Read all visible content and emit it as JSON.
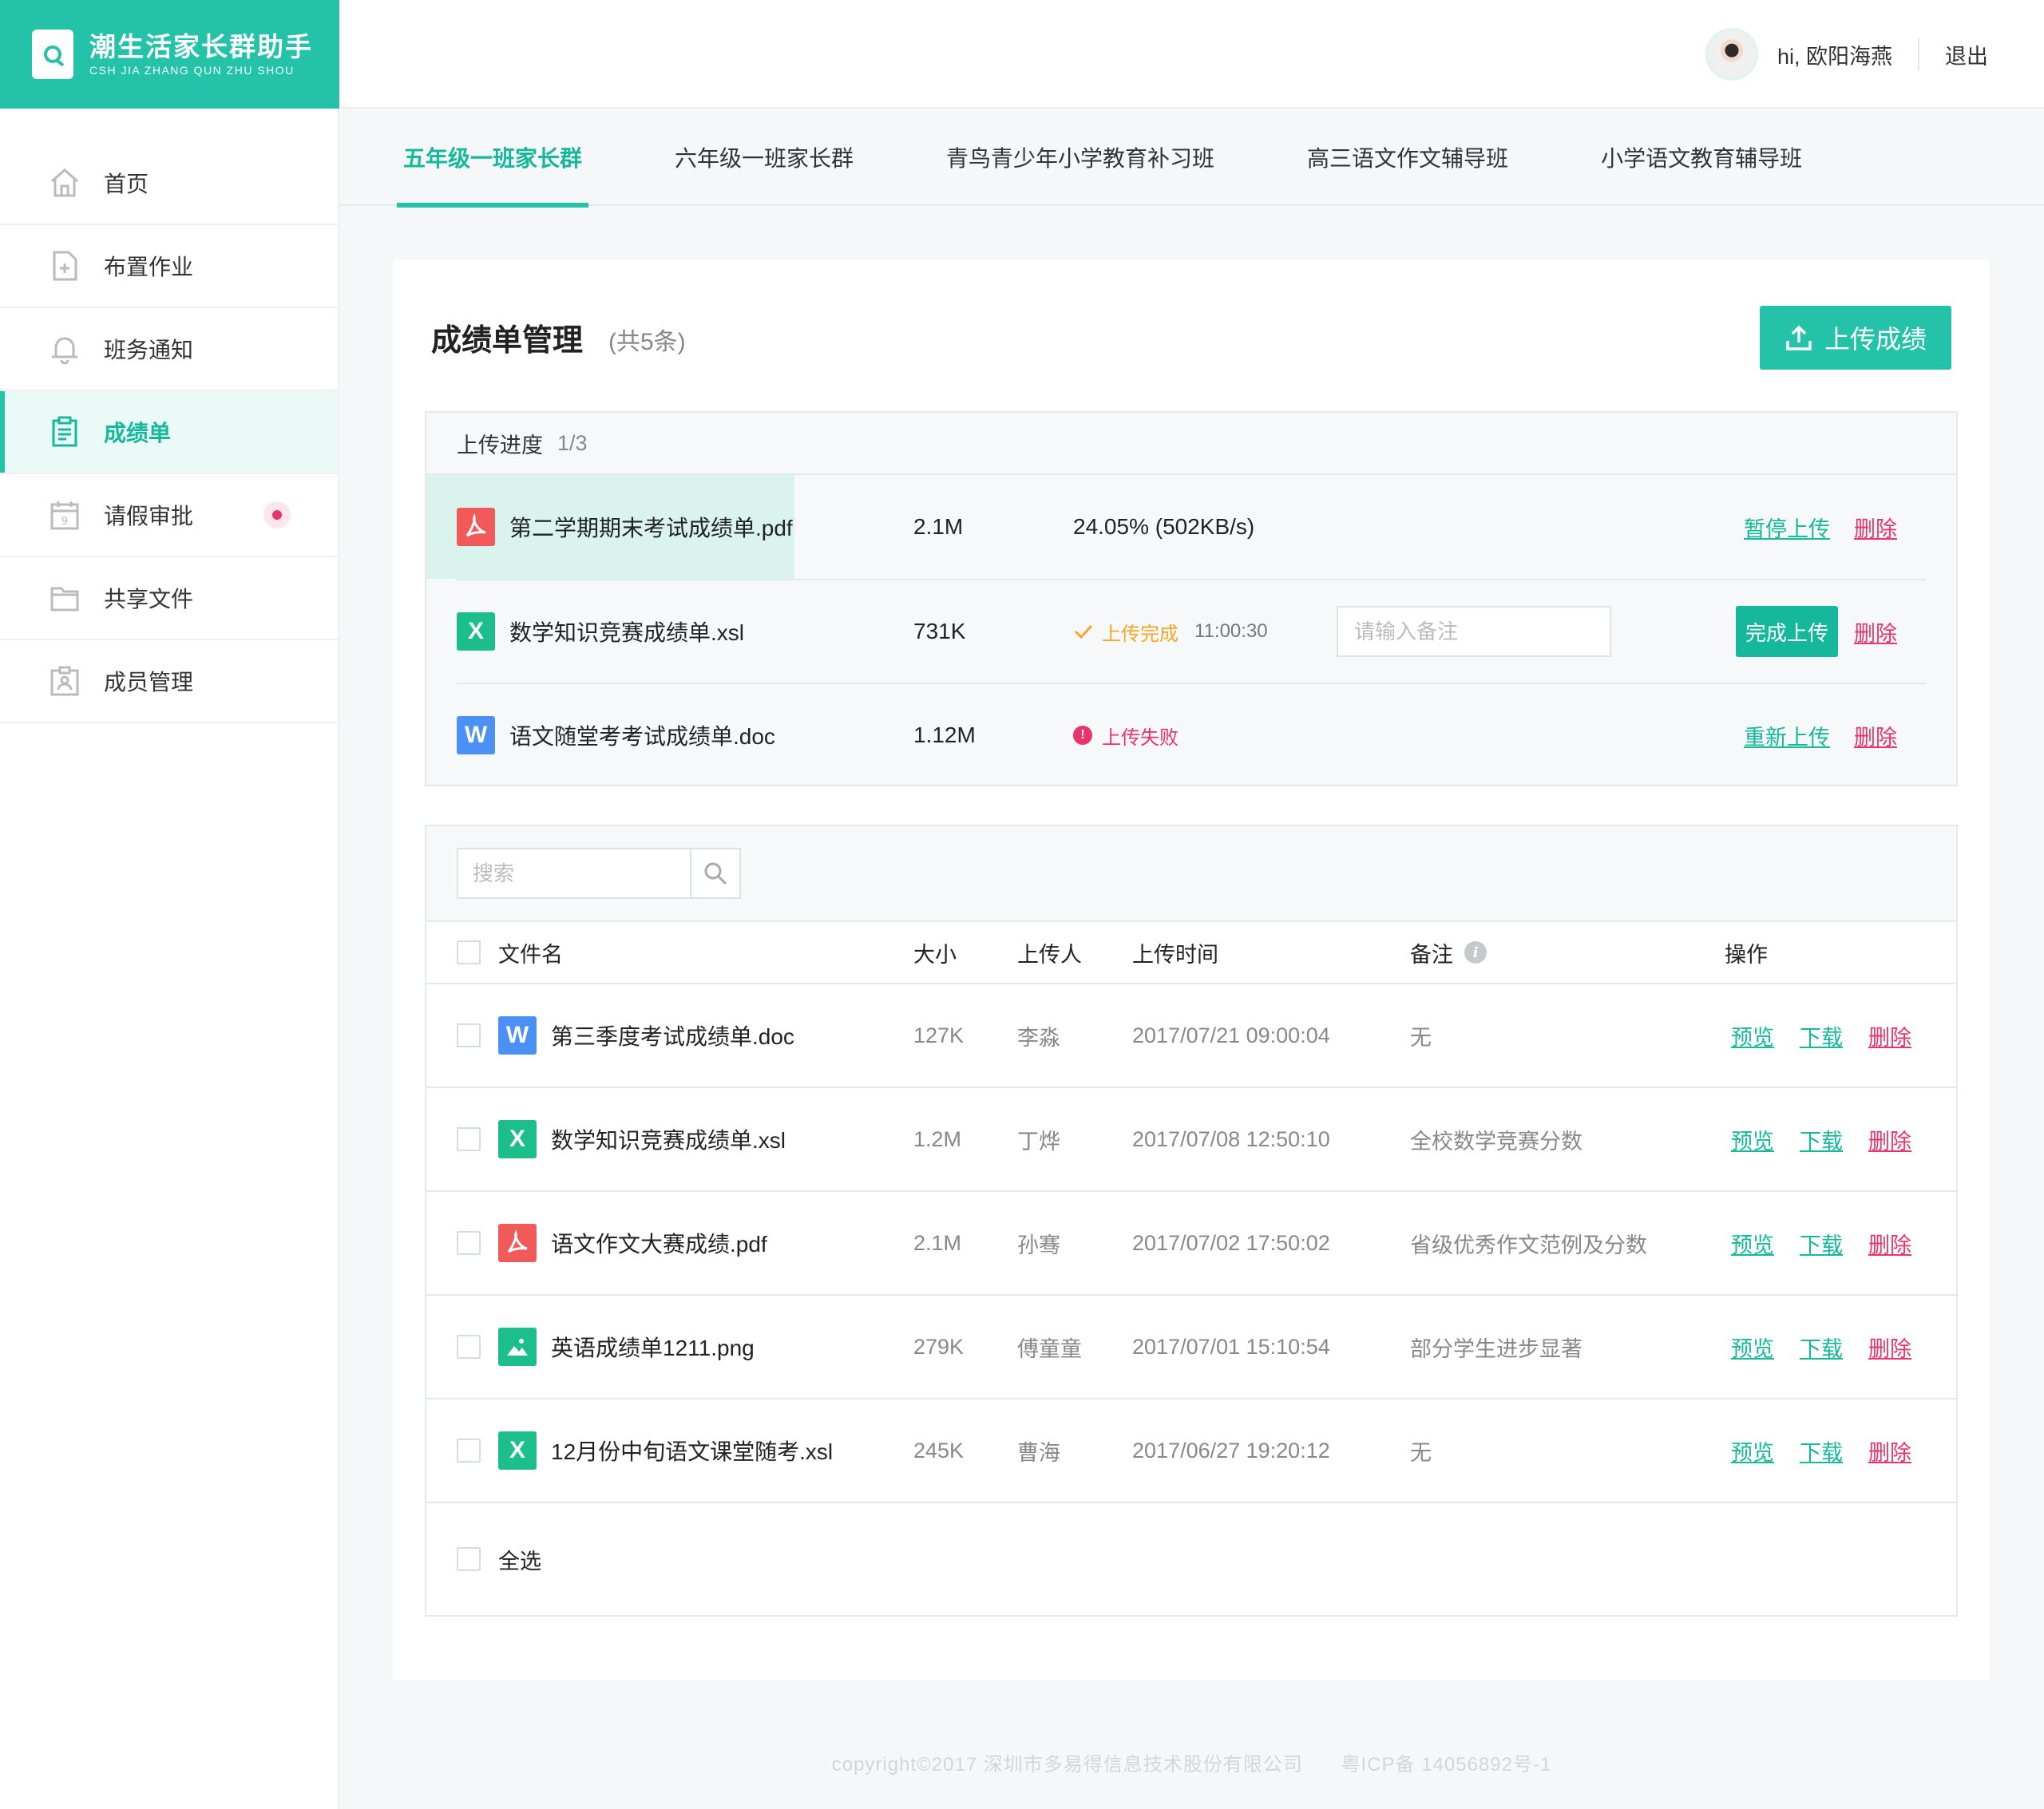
{
  "brand": {
    "title": "潮生活家长群助手",
    "subtitle": "CSH JIA ZHANG QUN ZHU SHOU",
    "color": "#24c2a8"
  },
  "header": {
    "greeting": "hi, 欧阳海燕",
    "logout": "退出"
  },
  "sidebar": {
    "items": [
      {
        "label": "首页",
        "icon": "home-icon"
      },
      {
        "label": "布置作业",
        "icon": "document-add-icon"
      },
      {
        "label": "班务通知",
        "icon": "bell-icon"
      },
      {
        "label": "成绩单",
        "icon": "clipboard-icon",
        "active": true
      },
      {
        "label": "请假审批",
        "icon": "calendar-icon",
        "badge": true
      },
      {
        "label": "共享文件",
        "icon": "folder-icon"
      },
      {
        "label": "成员管理",
        "icon": "members-icon"
      }
    ]
  },
  "tabs": [
    {
      "label": "五年级一班家长群",
      "active": true
    },
    {
      "label": "六年级一班家长群"
    },
    {
      "label": "青鸟青少年小学教育补习班"
    },
    {
      "label": "高三语文作文辅导班"
    },
    {
      "label": "小学语文教育辅导班"
    }
  ],
  "main": {
    "title": "成绩单管理",
    "count": "(共5条)",
    "upload_button": "上传成绩"
  },
  "upload_panel": {
    "label": "上传进度",
    "progress": "1/3",
    "rows": [
      {
        "type": "pdf",
        "name": "第二学期期末考试成绩单.pdf",
        "size": "2.1M",
        "status": "24.05% (502KB/s)",
        "progress": 0.2405,
        "action": "暂停上传",
        "delete": "删除"
      },
      {
        "type": "xls",
        "name": "数学知识竞赛成绩单.xsl",
        "size": "731K",
        "status": "上传完成",
        "time": "11:00:30",
        "remark_placeholder": "请输入备注",
        "action": "完成上传",
        "delete": "删除"
      },
      {
        "type": "doc",
        "name": "语文随堂考考试成绩单.doc",
        "size": "1.12M",
        "status": "上传失败",
        "action": "重新上传",
        "delete": "删除"
      }
    ]
  },
  "file_table": {
    "search_placeholder": "搜索",
    "columns": {
      "name": "文件名",
      "size": "大小",
      "uploader": "上传人",
      "time": "上传时间",
      "note": "备注",
      "ops": "操作"
    },
    "rows": [
      {
        "type": "doc",
        "name": "第三季度考试成绩单.doc",
        "size": "127K",
        "uploader": "李淼",
        "time": "2017/07/21 09:00:04",
        "note": "无"
      },
      {
        "type": "xls",
        "name": "数学知识竞赛成绩单.xsl",
        "size": "1.2M",
        "uploader": "丁烨",
        "time": "2017/07/08 12:50:10",
        "note": "全校数学竞赛分数"
      },
      {
        "type": "pdf",
        "name": "语文作文大赛成绩.pdf",
        "size": "2.1M",
        "uploader": "孙骞",
        "time": "2017/07/02 17:50:02",
        "note": "省级优秀作文范例及分数"
      },
      {
        "type": "img",
        "name": "英语成绩单1211.png",
        "size": "279K",
        "uploader": "傅童童",
        "time": "2017/07/01 15:10:54",
        "note": "部分学生进步显著"
      },
      {
        "type": "xls",
        "name": "12月份中旬语文课堂随考.xsl",
        "size": "245K",
        "uploader": "曹海",
        "time": "2017/06/27 19:20:12",
        "note": "无"
      }
    ],
    "ops": {
      "preview": "预览",
      "download": "下载",
      "delete": "删除"
    },
    "select_all": "全选"
  },
  "footer": {
    "copyright": "copyright©2017  深圳市多易得信息技术股份有限公司",
    "icp": "粤ICP备 14056892号-1"
  }
}
